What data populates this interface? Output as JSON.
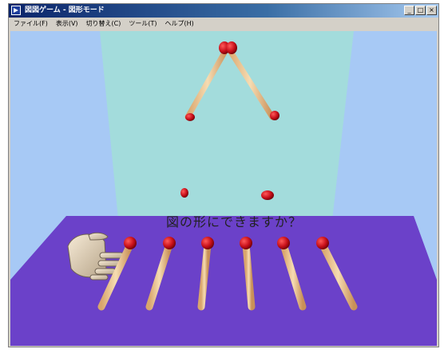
{
  "window": {
    "title": "図図ゲーム - 図形モード",
    "controls": {
      "minimize": "_",
      "maximize": "□",
      "close": "×"
    }
  },
  "menu": {
    "items": [
      "ファイル(F)",
      "表示(V)",
      "切り替え(C)",
      "ツール(T)",
      "ヘルプ(H)"
    ]
  },
  "scene": {
    "question": "図の形にできますか？",
    "colors": {
      "sky": "#a7c9f5",
      "panel": "#a3dcdc",
      "floor": "#6b41c9",
      "match_stick": "#f1cfa0",
      "match_head": "#c8101a"
    },
    "loose_match_count": 6
  }
}
